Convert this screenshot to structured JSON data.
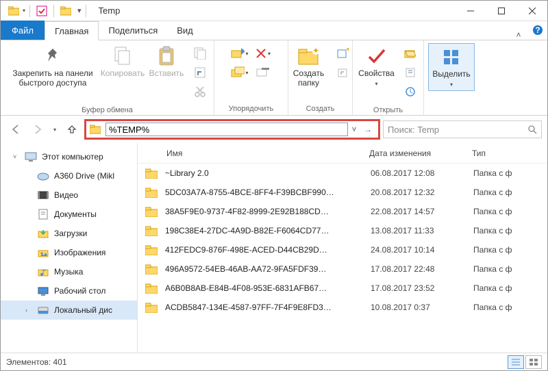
{
  "window": {
    "title": "Temp"
  },
  "tabs": {
    "file": "Файл",
    "home": "Главная",
    "share": "Поделиться",
    "view": "Вид"
  },
  "ribbon": {
    "pin": "Закрепить на панели быстрого доступа",
    "copy": "Копировать",
    "paste": "Вставить",
    "group_clipboard": "Буфер обмена",
    "group_organize": "Упорядочить",
    "new_folder": "Создать папку",
    "group_new": "Создать",
    "properties": "Свойства",
    "group_open": "Открыть",
    "select": "Выделить"
  },
  "nav": {
    "address_value": "%TEMP%",
    "search_placeholder": "Поиск: Temp"
  },
  "tree": {
    "items": [
      {
        "label": "Этот компьютер",
        "icon": "pc"
      },
      {
        "label": "A360 Drive (Mikl",
        "icon": "cloud"
      },
      {
        "label": "Видео",
        "icon": "video"
      },
      {
        "label": "Документы",
        "icon": "doc"
      },
      {
        "label": "Загрузки",
        "icon": "download"
      },
      {
        "label": "Изображения",
        "icon": "pic"
      },
      {
        "label": "Музыка",
        "icon": "music"
      },
      {
        "label": "Рабочий стол",
        "icon": "desktop"
      },
      {
        "label": "Локальный дис",
        "icon": "disk",
        "selected": true
      }
    ]
  },
  "columns": {
    "name": "Имя",
    "date": "Дата изменения",
    "type": "Тип"
  },
  "rows": [
    {
      "name": "~Library 2.0",
      "date": "06.08.2017 12:08",
      "type": "Папка с ф"
    },
    {
      "name": "5DC03A7A-8755-4BCE-8FF4-F39BCBF990…",
      "date": "20.08.2017 12:32",
      "type": "Папка с ф"
    },
    {
      "name": "38A5F9E0-9737-4F82-8999-2E92B188CD…",
      "date": "22.08.2017 14:57",
      "type": "Папка с ф"
    },
    {
      "name": "198C38E4-27DC-4A9D-B82E-F6064CD77…",
      "date": "13.08.2017 11:33",
      "type": "Папка с ф"
    },
    {
      "name": "412FEDC9-876F-498E-ACED-D44CB29D…",
      "date": "24.08.2017 10:14",
      "type": "Папка с ф"
    },
    {
      "name": "496A9572-54EB-46AB-AA72-9FA5FDF39…",
      "date": "17.08.2017 22:48",
      "type": "Папка с ф"
    },
    {
      "name": "A6B0B8AB-E84B-4F08-953E-6831AFB67…",
      "date": "17.08.2017 23:52",
      "type": "Папка с ф"
    },
    {
      "name": "ACDB5847-134E-4587-97FF-7F4F9E8FD3…",
      "date": "10.08.2017 0:37",
      "type": "Папка с ф"
    }
  ],
  "status": {
    "elements_label": "Элементов:",
    "elements_count": "401"
  }
}
